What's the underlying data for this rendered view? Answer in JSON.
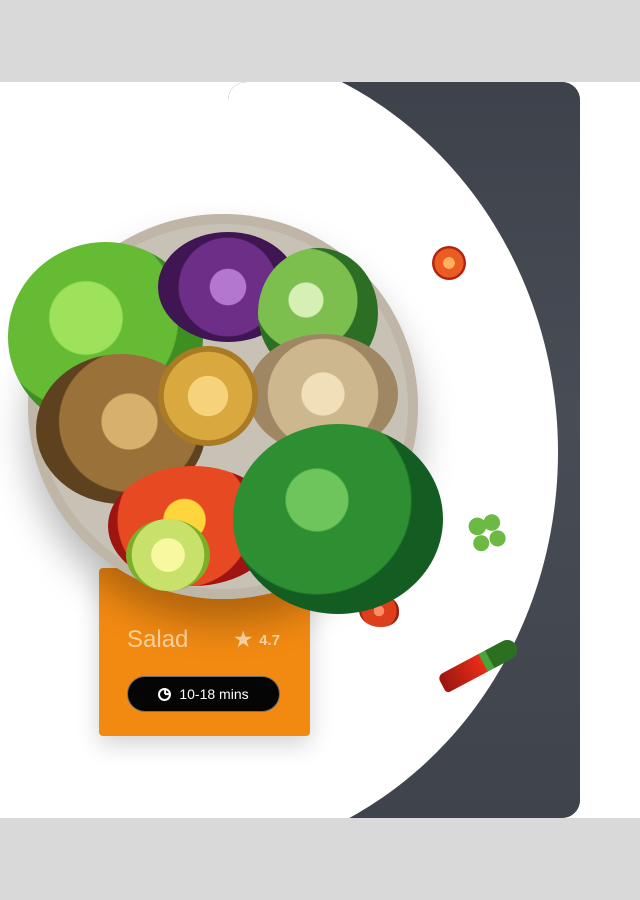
{
  "card": {
    "title": "Salad",
    "rating": "4.7",
    "time": "10-18 mins"
  },
  "colors": {
    "page_background": "#d9d9d9",
    "card_background": "#f28a12",
    "dark_panel": "#434750",
    "pill_background": "#050505"
  },
  "icons": {
    "rating": "star-icon",
    "time": "clock-icon"
  }
}
